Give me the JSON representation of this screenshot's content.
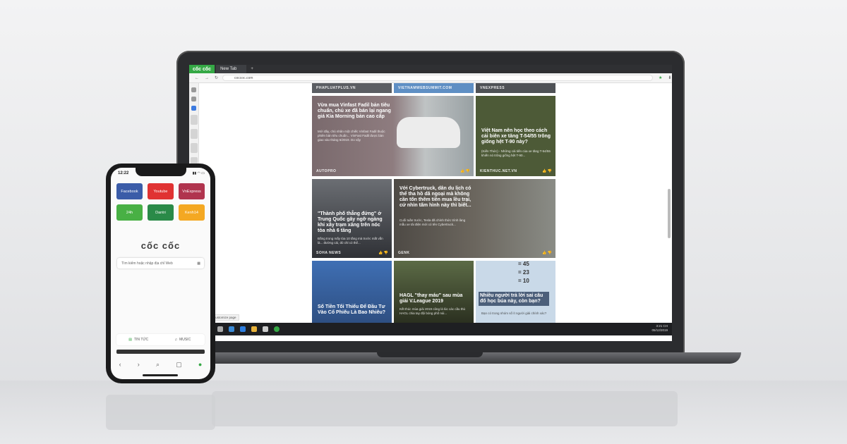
{
  "browser": {
    "logo": "cốc cốc",
    "tab_label": "New Tab",
    "new_tab": "+",
    "url": "coccoc.com"
  },
  "feed": {
    "top_sources": [
      "PHAPLUATPLUS.VN",
      "VIETNAMWEBSUMMIT.COM",
      "VNEXPRESS"
    ],
    "cards": [
      {
        "title": "Vừa mua Vinfast Fadil bản tiêu chuẩn, chủ xe đã bán lại ngang giá Kia Morning bản cao cấp",
        "summary": "Mới đây, chủ nhân một chiếc Vinfast Fadil thuộc phiên bản tiêu chuẩn... VinFast Fadil được bàn giao vào tháng 6/2019. Do vậy",
        "source": "AUTOPRO"
      },
      {
        "title": "Việt Nam nên học theo cách cải biên xe tăng T-54/55 trông giống hệt T-90 này?",
        "summary": "(Kiến Thức) - Những cải tiến của xe tăng T-54/55 khiến nó trông giống hệt T-90...",
        "source": "KIENTHUC.NET.VN"
      },
      {
        "title": "\"Thành phố thẳng đứng\" ở Trung Quốc gây ngỡ ngàng khi xây trạm xăng trên nóc tòa nhà 6 tầng",
        "summary": "Đằng trong mấy tòa 10 tầng mà trước mắt vẫn là... đường cái, đó chỉ có thể...",
        "source": "SOHA NEWS"
      },
      {
        "title": "Với Cybertruck, dân du lịch có thể tha hồ dã ngoại mà không cần tốn thêm tiền mua lều trại, cứ nhìn tấm hình này thì biết...",
        "summary": "Cuối tuần trước, Tesla đã chính thức trình làng mẫu xe tải điện mới có tên Cybertruck...",
        "source": "GENK"
      },
      {
        "title": "Số Tiền Tối Thiểu Để Đầu Tư Vào Cổ Phiếu Là Bao Nhiêu?",
        "summary": "",
        "source": ""
      },
      {
        "title": "HAGL \"thay máu\" sau mùa giải V.League 2019",
        "summary": "Kết thúc mùa giải 2019 cũng là lúc các cầu thủ HAGL chia tay đội bóng phố núi...",
        "source": ""
      },
      {
        "title": "Nhiều người trả lời sai câu đố học búa này, còn bạn?",
        "summary": "Bạn có trong nhóm số ít người giải chính xác?",
        "source": "",
        "puzzle": [
          "= 45",
          "= 23",
          "= 10"
        ]
      }
    ]
  },
  "customize_label": "Customize page",
  "taskbar": {
    "time": "3:21 CH",
    "date": "05/12/2019"
  },
  "phone": {
    "time": "12:22",
    "status_icons": "▮▮ ◠ ▭",
    "tiles": [
      {
        "label": "Facebook",
        "color": "#3b5ca8"
      },
      {
        "label": "Youtube",
        "color": "#e03232"
      },
      {
        "label": "VnExpress",
        "color": "#b0344e"
      },
      {
        "label": "24h",
        "color": "#48b044"
      },
      {
        "label": "Dantri",
        "color": "#2a8a48"
      },
      {
        "label": "Kenh14",
        "color": "#f4a822"
      }
    ],
    "logo": "cốc cốc",
    "search_placeholder": "Tìm kiếm hoặc nhập địa chỉ Web",
    "tab_news": "TIN TỨC",
    "tab_music": "MUSIC"
  },
  "colors": {
    "brand_green": "#35a845"
  }
}
